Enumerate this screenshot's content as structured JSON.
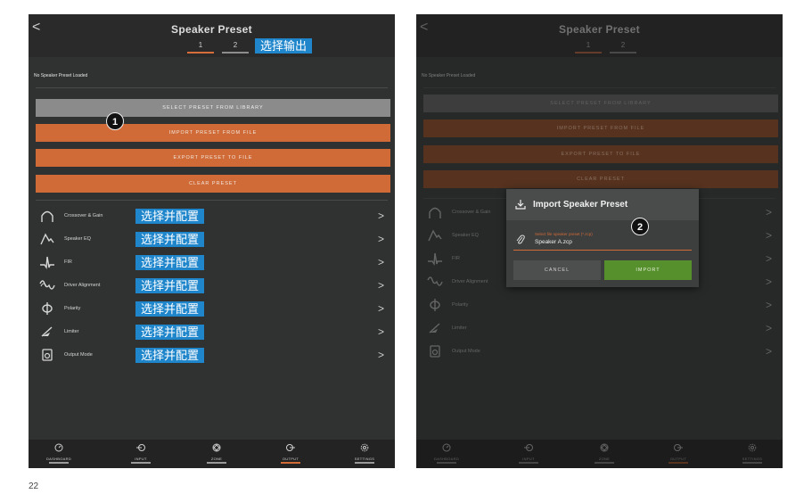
{
  "header": {
    "back": "<",
    "title": "Speaker Preset",
    "tabs": [
      "1",
      "2"
    ],
    "tag": "选择输出"
  },
  "status": "No Speaker Preset Loaded",
  "buttons": {
    "select": "SELECT PRESET FROM LIBRARY",
    "import": "IMPORT PRESET FROM FILE",
    "export": "EXPORT PRESET TO FILE",
    "clear": "CLEAR PRESET"
  },
  "menu": {
    "chevron": ">",
    "tag": "选择并配置",
    "items": [
      "Crossover & Gain",
      "Speaker EQ",
      "FIR",
      "Driver Alignment",
      "Polarity",
      "Limiter",
      "Output Mode"
    ]
  },
  "nav": [
    "DASHBOARD",
    "INPUT",
    "ZONE",
    "OUTPUT",
    "SETTINGS"
  ],
  "badges": [
    "1",
    "2"
  ],
  "dialog": {
    "title": "Import Speaker Preset",
    "hint": "Select file speaker preset (*.zcp)",
    "file": "Speaker A.zcp",
    "cancel": "CANCEL",
    "import": "IMPORT"
  },
  "page_number": "22",
  "colors": {
    "accent": "#d06b38",
    "import_green": "#56902c",
    "tag_blue": "#1f86cb",
    "panel": "#303232"
  }
}
